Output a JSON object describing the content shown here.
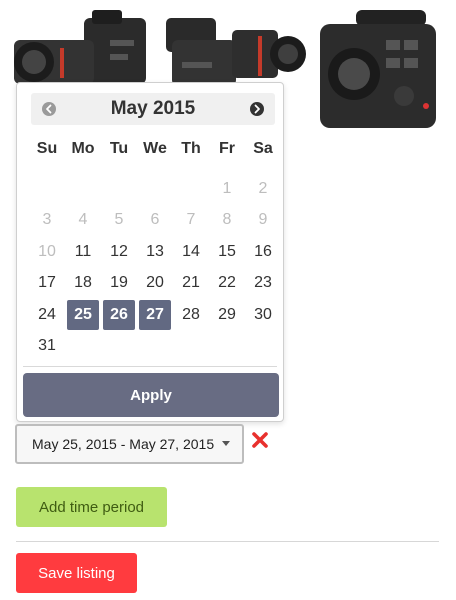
{
  "thumbnails": [
    {
      "icon": "camera-photo-icon"
    },
    {
      "icon": "camera-photo-icon"
    },
    {
      "icon": "camera-photo-icon"
    }
  ],
  "calendar": {
    "month_title": "May 2015",
    "prev_icon": "chevron-left-circle-icon",
    "next_icon": "chevron-right-circle-icon",
    "weekdays": [
      "Su",
      "Mo",
      "Tu",
      "We",
      "Th",
      "Fr",
      "Sa"
    ],
    "days": [
      {
        "label": "",
        "state": "empty"
      },
      {
        "label": "",
        "state": "empty"
      },
      {
        "label": "",
        "state": "empty"
      },
      {
        "label": "",
        "state": "empty"
      },
      {
        "label": "",
        "state": "empty"
      },
      {
        "label": "1",
        "state": "disabled"
      },
      {
        "label": "2",
        "state": "disabled"
      },
      {
        "label": "3",
        "state": "disabled"
      },
      {
        "label": "4",
        "state": "disabled"
      },
      {
        "label": "5",
        "state": "disabled"
      },
      {
        "label": "6",
        "state": "disabled"
      },
      {
        "label": "7",
        "state": "disabled"
      },
      {
        "label": "8",
        "state": "disabled"
      },
      {
        "label": "9",
        "state": "disabled"
      },
      {
        "label": "10",
        "state": "disabled"
      },
      {
        "label": "11",
        "state": "available"
      },
      {
        "label": "12",
        "state": "available"
      },
      {
        "label": "13",
        "state": "available"
      },
      {
        "label": "14",
        "state": "available"
      },
      {
        "label": "15",
        "state": "available"
      },
      {
        "label": "16",
        "state": "available"
      },
      {
        "label": "17",
        "state": "available"
      },
      {
        "label": "18",
        "state": "available"
      },
      {
        "label": "19",
        "state": "available"
      },
      {
        "label": "20",
        "state": "available"
      },
      {
        "label": "21",
        "state": "available"
      },
      {
        "label": "22",
        "state": "available"
      },
      {
        "label": "23",
        "state": "available"
      },
      {
        "label": "24",
        "state": "available"
      },
      {
        "label": "25",
        "state": "selected"
      },
      {
        "label": "26",
        "state": "selected"
      },
      {
        "label": "27",
        "state": "selected"
      },
      {
        "label": "28",
        "state": "available"
      },
      {
        "label": "29",
        "state": "available"
      },
      {
        "label": "30",
        "state": "available"
      },
      {
        "label": "31",
        "state": "available"
      }
    ],
    "apply_label": "Apply"
  },
  "range": {
    "value": "May 25, 2015 - May 27, 2015",
    "remove_icon": "close-x-icon"
  },
  "actions": {
    "add_time_period_label": "Add time period",
    "save_listing_label": "Save listing"
  },
  "colors": {
    "selected_day": "#626982",
    "apply_button": "#686c83",
    "add_button": "#b8e36e",
    "add_button_text": "#3f5c12",
    "save_button": "#ff3b3f",
    "remove_icon": "#e8302d",
    "disabled_day": "#bdbdbd"
  }
}
